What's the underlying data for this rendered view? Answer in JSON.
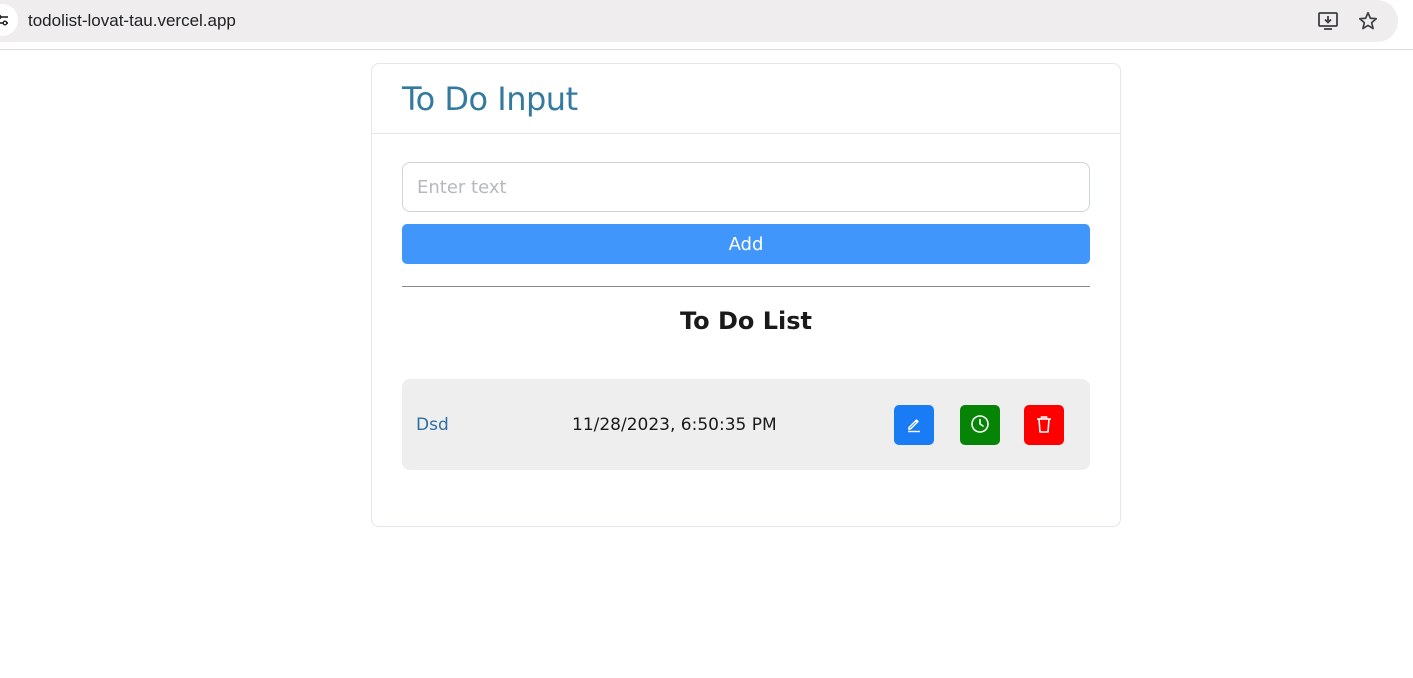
{
  "browser": {
    "url": "todolist-lovat-tau.vercel.app",
    "icons": [
      "site-settings-icon",
      "install-app-icon",
      "bookmark-star-icon"
    ]
  },
  "input_card": {
    "title": "To Do Input",
    "input_placeholder": "Enter text",
    "input_value": "",
    "add_label": "Add"
  },
  "list": {
    "title": "To Do List",
    "items": [
      {
        "text": "Dsd",
        "date": "11/28/2023, 6:50:35 PM",
        "actions": [
          "edit-icon",
          "clock-icon",
          "trash-icon"
        ]
      }
    ]
  },
  "colors": {
    "title": "#347aa0",
    "add_button": "#4196fb",
    "edit_button": "#1a7cf5",
    "clock_button": "#068405",
    "delete_button": "#fe0000",
    "item_background": "#eeeeee"
  }
}
